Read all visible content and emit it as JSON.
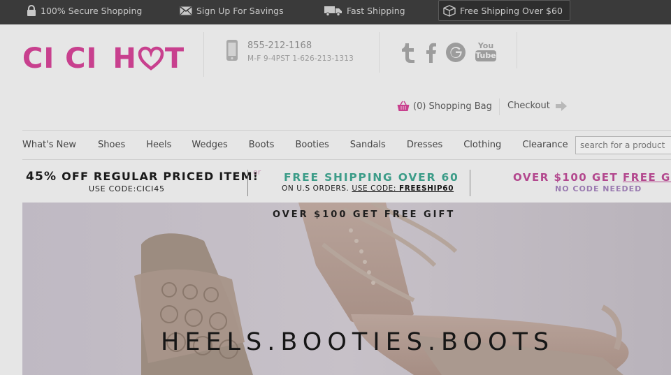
{
  "topbar": {
    "secure": "100% Secure Shopping",
    "signup": "Sign Up For Savings",
    "fast": "Fast Shipping",
    "free": "Free Shipping Over $60"
  },
  "logo": {
    "part1": "CI CI",
    "part2a": "H",
    "part2b": "T"
  },
  "contact": {
    "phone": "855-212-1168",
    "hours": "M-F 9-4PST 1-626-213-1313"
  },
  "social": {
    "youtube_top": "You",
    "youtube_bottom": "Tube"
  },
  "cart": {
    "label": "(0) Shopping Bag",
    "checkout": "Checkout"
  },
  "nav": [
    "What's New",
    "Shoes",
    "Heels",
    "Wedges",
    "Boots",
    "Booties",
    "Sandals",
    "Dresses",
    "Clothing",
    "Clearance"
  ],
  "search": {
    "placeholder": "search for a product"
  },
  "promo": {
    "p1_pct": "45%",
    "p1_rest": "OFF REGULAR PRICED ITEM!",
    "p1_code": "USE CODE:CICI45",
    "or": "or",
    "p2_main": "FREE SHIPPING OVER 60",
    "p2_sub": "ON U.S ORDERS.",
    "p2_code_label": "USE CODE:",
    "p2_code": "FREESHIP60",
    "p3_main": "OVER $100 GET",
    "p3_gift": "FREE GIFT !",
    "p3_sub": "NO CODE NEEDED"
  },
  "hero": {
    "top_text": "OVER $100 GET FREE GIFT",
    "tagline": "HEELS.BOOTIES.BOOTS"
  },
  "colors": {
    "brand": "#c8408e",
    "topbar": "#3a3a3a",
    "teal": "#3c9c88"
  }
}
